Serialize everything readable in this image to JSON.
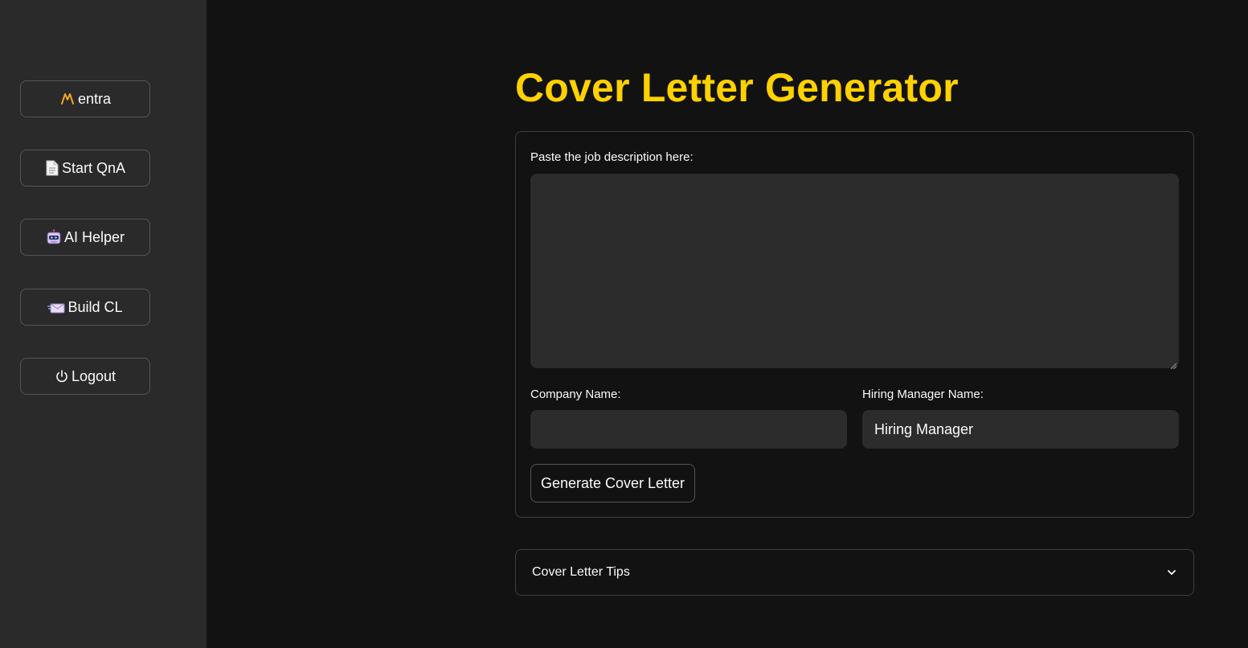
{
  "sidebar": {
    "items": [
      {
        "label": "entra",
        "icon": "mentra-logo-icon"
      },
      {
        "label": "Start QnA",
        "icon": "document-icon"
      },
      {
        "label": "AI Helper",
        "icon": "robot-icon"
      },
      {
        "label": "Build CL",
        "icon": "envelope-icon"
      },
      {
        "label": "Logout",
        "icon": "power-icon"
      }
    ]
  },
  "main": {
    "title": "Cover Letter Generator",
    "form": {
      "job_description": {
        "label": "Paste the job description here:",
        "value": ""
      },
      "company_name": {
        "label": "Company Name:",
        "value": ""
      },
      "hiring_manager": {
        "label": "Hiring Manager Name:",
        "value": "Hiring Manager"
      },
      "submit_label": "Generate Cover Letter"
    },
    "expander": {
      "label": "Cover Letter Tips",
      "expanded": false
    }
  },
  "colors": {
    "accent": "#ffd100",
    "background": "#121212",
    "sidebar": "#2a2a2a",
    "input": "#2c2c2c"
  }
}
